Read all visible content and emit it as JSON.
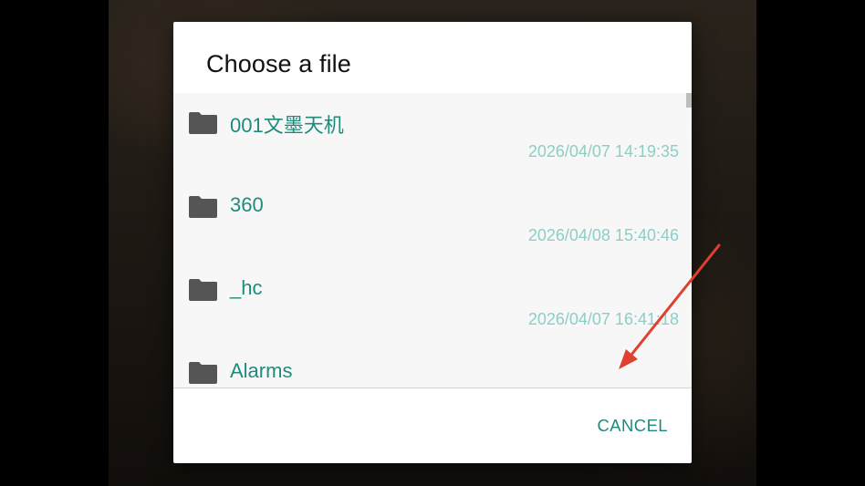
{
  "dialog": {
    "title": "Choose a file",
    "cancel_label": "CANCEL"
  },
  "files": [
    {
      "name": "001文墨天机",
      "date": "2026/04/07 14:19:35",
      "icon": "folder-icon"
    },
    {
      "name": "360",
      "date": "2026/04/08 15:40:46",
      "icon": "folder-icon"
    },
    {
      "name": "_hc",
      "date": "2026/04/07 16:41:18",
      "icon": "folder-icon"
    },
    {
      "name": "Alarms",
      "date": "",
      "icon": "folder-icon"
    }
  ],
  "colors": {
    "accent": "#1e8b7d",
    "date_text": "#8dcec6",
    "folder_icon": "#555555",
    "annotation_arrow": "#e04030"
  }
}
